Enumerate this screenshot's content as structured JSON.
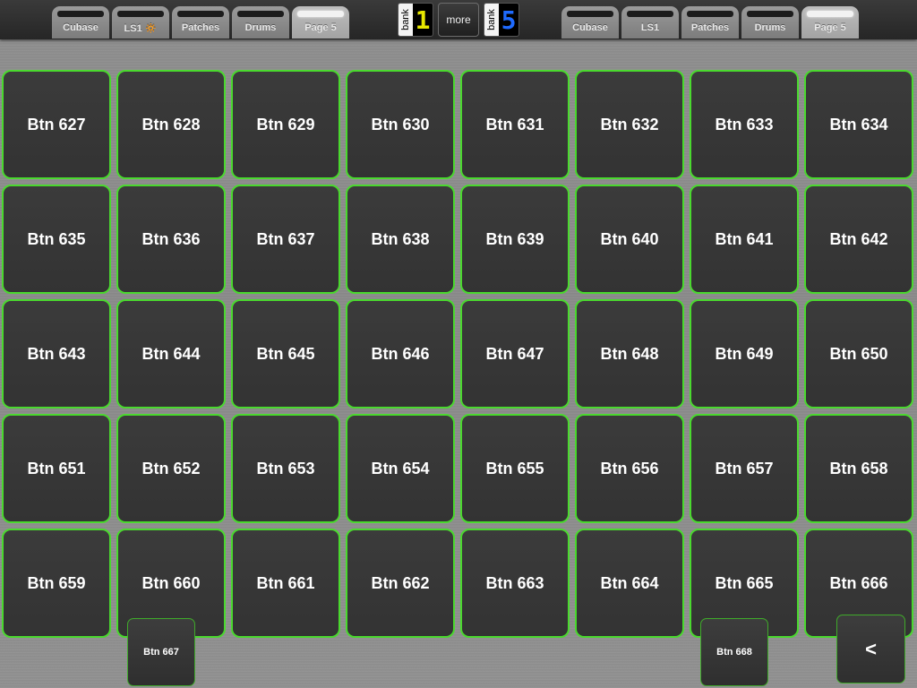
{
  "tabs_left": [
    {
      "label": "Cubase",
      "active": false
    },
    {
      "label": "LS1 🔅",
      "active": false
    },
    {
      "label": "Patches",
      "active": false
    },
    {
      "label": "Drums",
      "active": false
    },
    {
      "label": "Page 5",
      "active": true
    }
  ],
  "tabs_right": [
    {
      "label": "Cubase",
      "active": false
    },
    {
      "label": "LS1",
      "active": false
    },
    {
      "label": "Patches",
      "active": false
    },
    {
      "label": "Drums",
      "active": false
    },
    {
      "label": "Page 5",
      "active": true
    }
  ],
  "bank_left": {
    "word": "bank",
    "digit": "1",
    "color": "#e8e800"
  },
  "bank_right": {
    "word": "bank",
    "digit": "5",
    "color": "#1f6bff"
  },
  "more_label": "more",
  "grid": {
    "rows": 5,
    "cols": 8,
    "border_color": "#4ad92e",
    "buttons": [
      "Btn 627",
      "Btn 628",
      "Btn 629",
      "Btn 630",
      "Btn 631",
      "Btn 632",
      "Btn 633",
      "Btn 634",
      "Btn 635",
      "Btn 636",
      "Btn 637",
      "Btn 638",
      "Btn 639",
      "Btn 640",
      "Btn 641",
      "Btn 642",
      "Btn 643",
      "Btn 644",
      "Btn 645",
      "Btn 646",
      "Btn 647",
      "Btn 648",
      "Btn 649",
      "Btn 650",
      "Btn 651",
      "Btn 652",
      "Btn 653",
      "Btn 654",
      "Btn 655",
      "Btn 656",
      "Btn 657",
      "Btn 658",
      "Btn 659",
      "Btn 660",
      "Btn 661",
      "Btn 662",
      "Btn 663",
      "Btn 664",
      "Btn 665",
      "Btn 666"
    ]
  },
  "extra_buttons": {
    "left": "Btn 667",
    "right": "Btn 668",
    "back": "<"
  }
}
